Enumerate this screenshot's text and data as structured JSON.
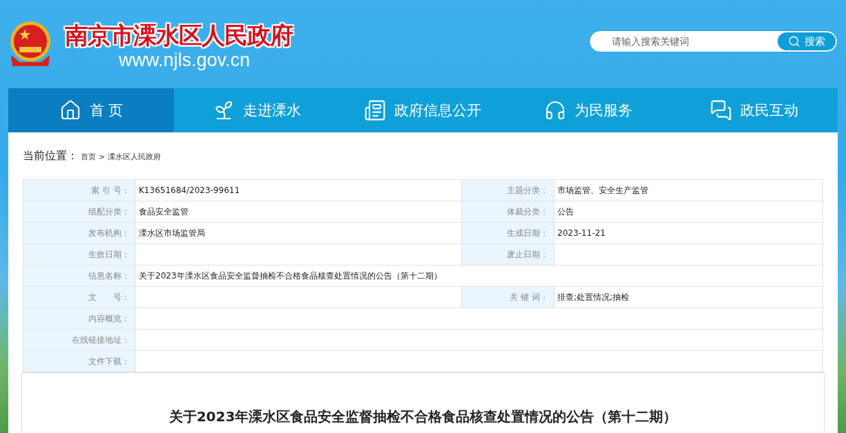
{
  "header": {
    "site_title": "南京市溧水区人民政府",
    "site_url": "www.njls.gov.cn",
    "search": {
      "placeholder": "请输入搜索关键词",
      "button": "搜索"
    }
  },
  "nav": [
    {
      "label": "首 页",
      "selected": true
    },
    {
      "label": "走进溧水",
      "selected": false
    },
    {
      "label": "政府信息公开",
      "selected": false
    },
    {
      "label": "为民服务",
      "selected": false
    },
    {
      "label": "政民互动",
      "selected": false
    }
  ],
  "breadcrumb": {
    "label": "当前位置：",
    "items": [
      "首页",
      "溧水区人民政府"
    ],
    "separator": ">"
  },
  "info_table": [
    {
      "kind": "pair",
      "cells": [
        {
          "label": "索 引 号：",
          "value": "K13651684/2023-99611"
        },
        {
          "label": "主题分类：",
          "value": "市场监管、安全生产监管"
        }
      ]
    },
    {
      "kind": "pair",
      "cells": [
        {
          "label": "组配分类：",
          "value": "食品安全监管"
        },
        {
          "label": "体裁分类：",
          "value": "公告"
        }
      ]
    },
    {
      "kind": "pair",
      "cells": [
        {
          "label": "发布机构：",
          "value": "溧水区市场监管局"
        },
        {
          "label": "生成日期：",
          "value": "2023-11-21"
        }
      ]
    },
    {
      "kind": "pair",
      "cells": [
        {
          "label": "生效日期："
        },
        {
          "label": "废止日期："
        }
      ]
    },
    {
      "kind": "full",
      "cells": [
        {
          "label": "信息名称：",
          "value": "关于2023年溧水区食品安全监督抽检不合格食品核查处置情况的公告（第十二期）"
        }
      ]
    },
    {
      "kind": "pair",
      "cells": [
        {
          "label": "文　　号："
        },
        {
          "label": "关 键 词：",
          "value": "排查;处置情况;抽检"
        }
      ]
    },
    {
      "kind": "full",
      "cells": [
        {
          "label": "内容概览："
        }
      ]
    },
    {
      "kind": "full",
      "cells": [
        {
          "label": "在线链接地址："
        }
      ]
    },
    {
      "kind": "full",
      "cells": [
        {
          "label": "文件下载："
        }
      ]
    }
  ],
  "article": {
    "title": "关于2023年溧水区食品安全监督抽检不合格食品核查处置情况的公告（第十二期）"
  }
}
